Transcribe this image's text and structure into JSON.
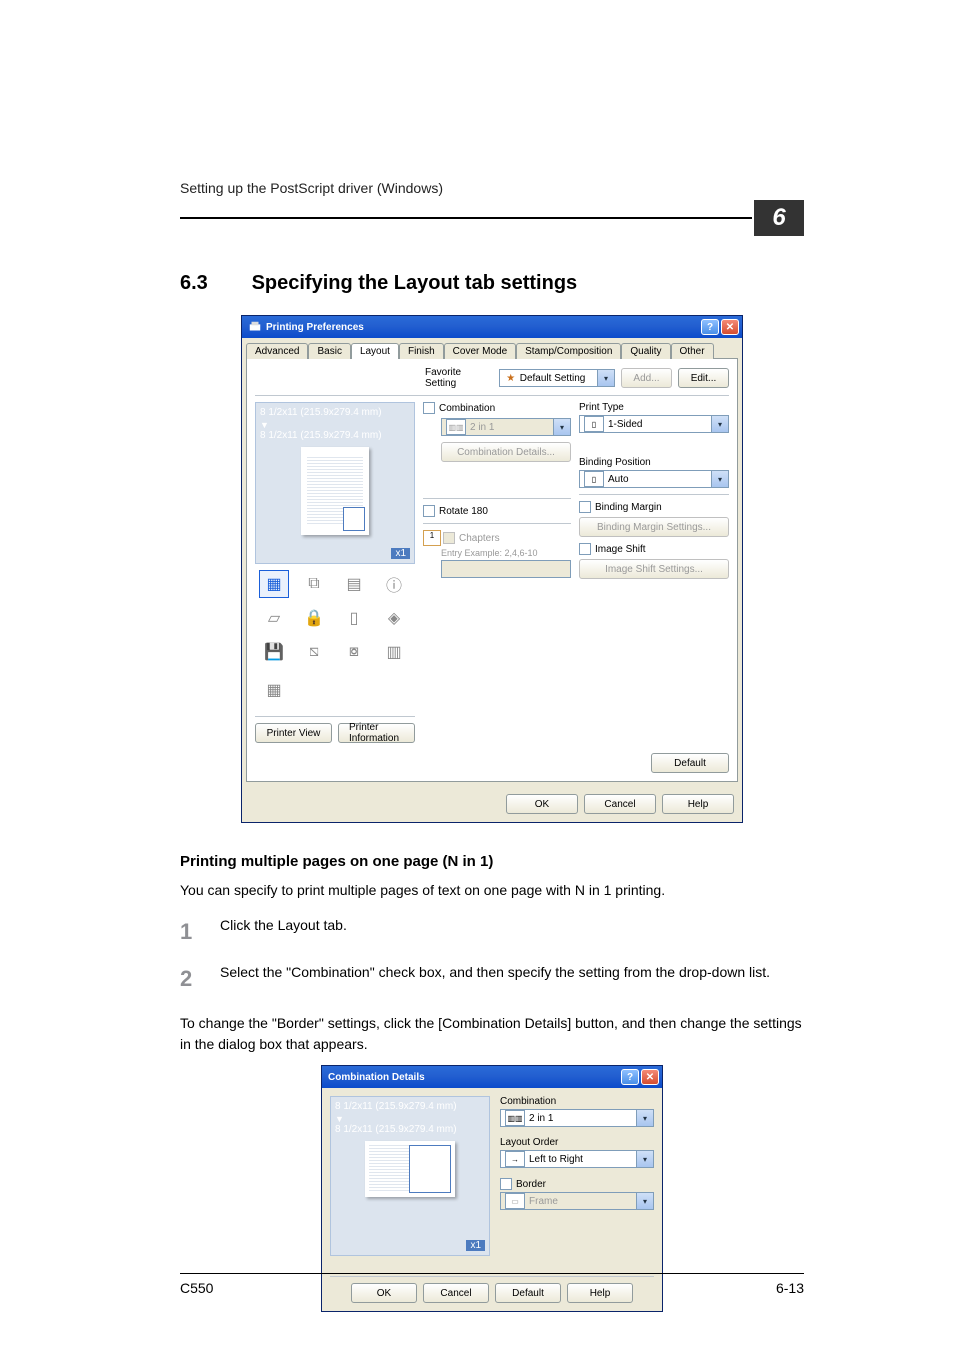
{
  "header": {
    "running_head": "Setting up the PostScript driver (Windows)",
    "chapter_number": "6"
  },
  "section": {
    "number": "6.3",
    "title": "Specifying the Layout tab settings"
  },
  "dialog1": {
    "title": "Printing Preferences",
    "tabs": [
      "Advanced",
      "Basic",
      "Layout",
      "Finish",
      "Cover Mode",
      "Stamp/Composition",
      "Quality",
      "Other"
    ],
    "active_tab": "Layout",
    "favorite": {
      "label": "Favorite Setting",
      "value": "Default Setting",
      "add": "Add...",
      "edit": "Edit..."
    },
    "preview": {
      "size1": "8 1/2x11 (215.9x279.4 mm)",
      "size2": "8 1/2x11 (215.9x279.4 mm)",
      "zoom": "x1",
      "printer_view": "Printer View",
      "printer_info": "Printer Information"
    },
    "combination": {
      "label": "Combination",
      "value": "2 in 1",
      "details": "Combination Details..."
    },
    "rotate": "Rotate 180",
    "chapters": {
      "label": "Chapters",
      "example": "Entry Example: 2,4,6-10"
    },
    "print_type": {
      "label": "Print Type",
      "value": "1-Sided"
    },
    "binding_position": {
      "label": "Binding Position",
      "value": "Auto"
    },
    "binding_margin": {
      "label": "Binding Margin",
      "settings": "Binding Margin Settings..."
    },
    "image_shift": {
      "label": "Image Shift",
      "settings": "Image Shift Settings..."
    },
    "default_btn": "Default",
    "buttons": {
      "ok": "OK",
      "cancel": "Cancel",
      "help": "Help"
    }
  },
  "subhead": "Printing multiple pages on one page (N in 1)",
  "para1": "You can specify to print multiple pages of text on one page with N in 1 printing.",
  "steps": {
    "s1": "Click the Layout tab.",
    "s2": "Select the \"Combination\" check box, and then specify the setting from the drop-down list."
  },
  "para2": "To change the \"Border\" settings, click the [Combination Details] button, and then change the settings in the dialog box that appears.",
  "dialog2": {
    "title": "Combination Details",
    "size1": "8 1/2x11 (215.9x279.4 mm)",
    "size2": "8 1/2x11 (215.9x279.4 mm)",
    "zoom": "x1",
    "combination": {
      "label": "Combination",
      "value": "2 in 1"
    },
    "layout_order": {
      "label": "Layout Order",
      "value": "Left to Right"
    },
    "border": {
      "label": "Border",
      "value": "Frame"
    },
    "buttons": {
      "ok": "OK",
      "cancel": "Cancel",
      "default": "Default",
      "help": "Help"
    }
  },
  "footer": {
    "model": "C550",
    "page": "6-13"
  },
  "chart_data": null
}
